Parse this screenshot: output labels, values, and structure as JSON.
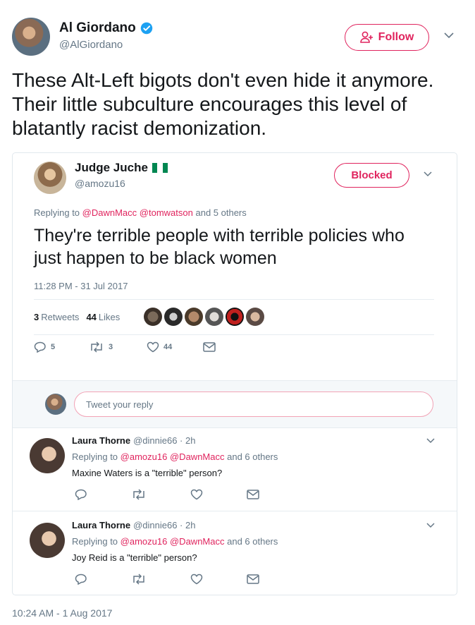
{
  "author": {
    "name": "Al Giordano",
    "handle": "@AlGiordano"
  },
  "follow_label": "Follow",
  "tweet_text": "These Alt-Left bigots don't even hide it anymore. Their little subculture encourages this level of blatantly racist demonization.",
  "quoted": {
    "name": "Judge Juche",
    "handle": "@amozu16",
    "blocked_label": "Blocked",
    "replying_prefix": "Replying to",
    "mention1": "@DawnMacc",
    "mention2": "@tomwatson",
    "replying_suffix": "and 5 others",
    "text": "They're terrible people with terrible policies who just happen to be black women",
    "timestamp": "11:28 PM - 31 Jul 2017",
    "retweets_count": "3",
    "retweets_label": "Retweets",
    "likes_count": "44",
    "likes_label": "Likes",
    "reply_count": "5",
    "retweet_count": "3",
    "like_count": "44",
    "reply_placeholder": "Tweet your reply",
    "flag_colors": [
      "#008751",
      "#ffffff",
      "#008751"
    ]
  },
  "replies": [
    {
      "name": "Laura Thorne",
      "meta": "@dinnie66 · 2h",
      "replying_prefix": "Replying to",
      "mention1": "@amozu16",
      "mention2": "@DawnMacc",
      "replying_suffix": "and 6 others",
      "text": "Maxine Waters is a \"terrible\" person?"
    },
    {
      "name": "Laura Thorne",
      "meta": "@dinnie66 · 2h",
      "replying_prefix": "Replying to",
      "mention1": "@amozu16",
      "mention2": "@DawnMacc",
      "replying_suffix": "and 6 others",
      "text": "Joy Reid is a \"terrible\" person?"
    }
  ],
  "footer_timestamp": "10:24 AM - 1 Aug 2017",
  "colors": {
    "accent": "#e0245e",
    "verified": "#1da1f2",
    "muted": "#657786"
  }
}
